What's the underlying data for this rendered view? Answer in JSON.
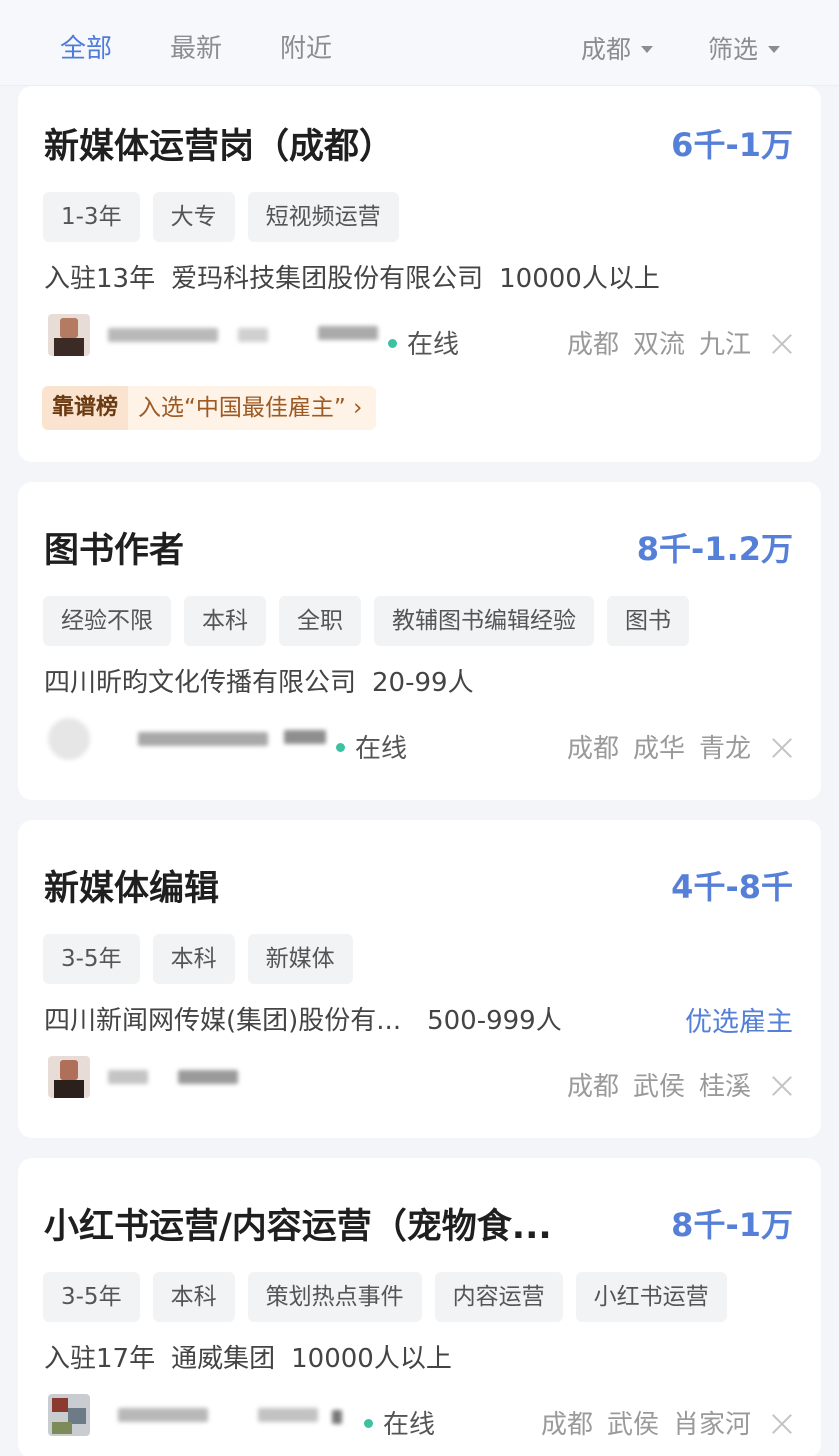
{
  "header": {
    "tabs": [
      {
        "label": "全部"
      },
      {
        "label": "最新"
      },
      {
        "label": "附近"
      }
    ],
    "city_filter": "成都",
    "filter": "筛选",
    "active_color": "#4f7bdc"
  },
  "jobs": [
    {
      "title": "新媒体运营岗（成都）",
      "salary": "6千-1万",
      "tags": [
        "1-3年",
        "大专",
        "短视频运营"
      ],
      "company_age": "入驻13年",
      "company": "爱玛科技集团股份有限公司",
      "size": "10000人以上",
      "online": "在线",
      "location": [
        "成都",
        "双流",
        "九江"
      ],
      "badge": {
        "label": "靠谱榜",
        "text": "入选“中国最佳雇主”"
      }
    },
    {
      "title": "图书作者",
      "salary": "8千-1.2万",
      "tags": [
        "经验不限",
        "本科",
        "全职",
        "教辅图书编辑经验",
        "图书"
      ],
      "company": "四川昕昀文化传播有限公司",
      "size": "20-99人",
      "online": "在线",
      "location": [
        "成都",
        "成华",
        "青龙"
      ]
    },
    {
      "title": "新媒体编辑",
      "salary": "4千-8千",
      "tags": [
        "3-5年",
        "本科",
        "新媒体"
      ],
      "company": "四川新闻网传媒(集团)股份有...",
      "size": "500-999人",
      "premium": "优选雇主",
      "location": [
        "成都",
        "武侯",
        "桂溪"
      ]
    },
    {
      "title": "小红书运营/内容运营（宠物食...",
      "salary": "8千-1万",
      "tags": [
        "3-5年",
        "本科",
        "策划热点事件",
        "内容运营",
        "小红书运营"
      ],
      "company_age": "入驻17年",
      "company": "通威集团",
      "size": "10000人以上",
      "online": "在线",
      "location": [
        "成都",
        "武侯",
        "肖家河"
      ]
    }
  ]
}
